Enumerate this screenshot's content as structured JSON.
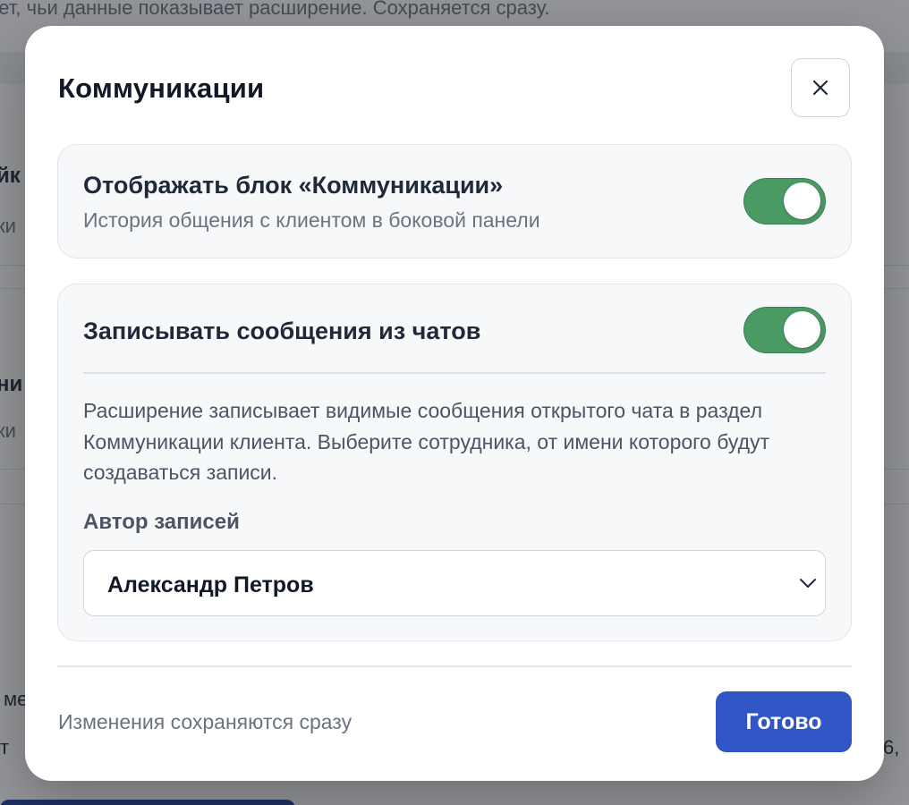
{
  "background": {
    "top_text": "ает, чьи данные показывает расширение. Сохраняется сразу.",
    "fragments": [
      "йк",
      "ки",
      "ни",
      "ки",
      "ме",
      "т",
      "6,"
    ]
  },
  "modal": {
    "title": "Коммуникации",
    "close_icon": "close-icon",
    "show_block": {
      "title": "Отображать блок «Коммуникации»",
      "subtitle": "История общения с клиентом в боковой панели",
      "enabled": true
    },
    "record_chats": {
      "title": "Записывать сообщения из чатов",
      "enabled": true,
      "description": "Расширение записывает видимые сообщения открытого чата в раздел Коммуникации клиента. Выберите сотрудника, от имени которого будут создаваться записи.",
      "author_label": "Автор записей",
      "author_value": "Александр Петров",
      "chevron_icon": "chevron-down-icon"
    },
    "footer": {
      "note": "Изменения сохраняются сразу",
      "done_label": "Готово"
    }
  },
  "colors": {
    "toggle_on": "#4a9a63",
    "primary": "#2f56c4",
    "overlay": "rgba(30,34,40,0.48)"
  }
}
